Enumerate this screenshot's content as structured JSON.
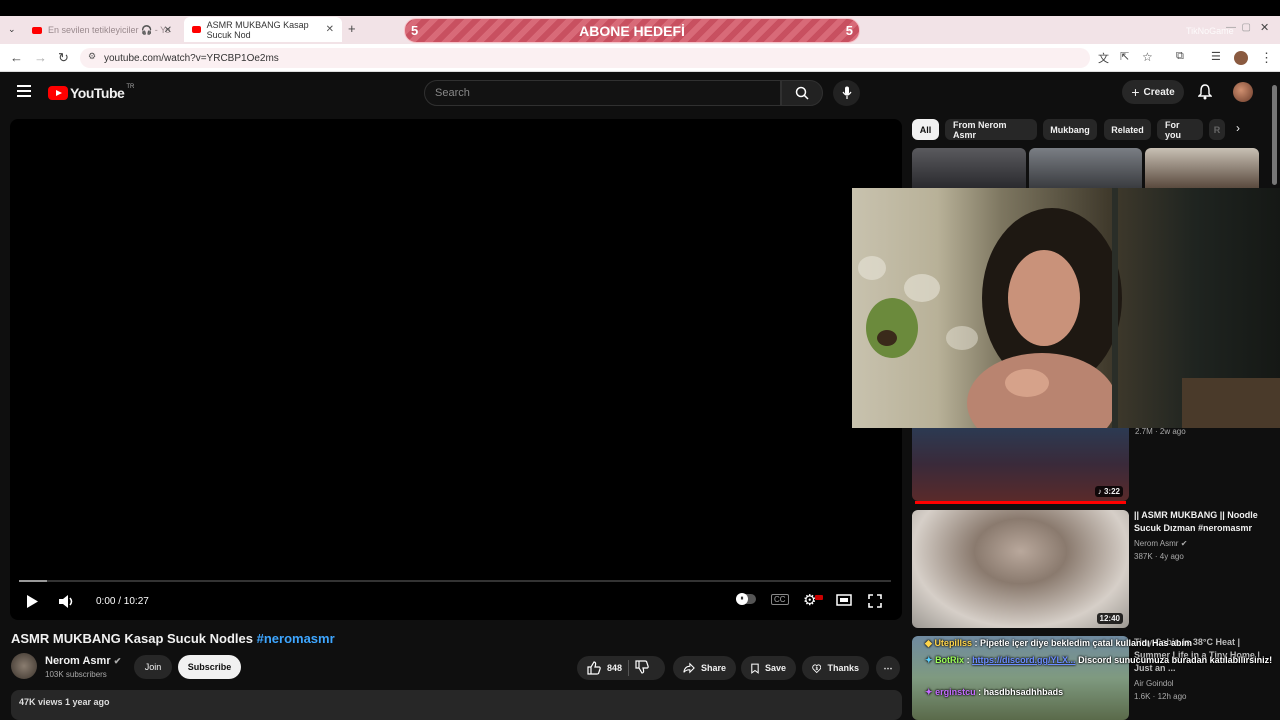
{
  "browser": {
    "tabs": [
      {
        "title": "En sevilen tetikleyiciler 🎧 - Yo",
        "active": false
      },
      {
        "title": "ASMR MUKBANG Kasap Sucuk Nod",
        "active": true
      }
    ],
    "new_tab": "+",
    "url": "youtube.com/watch?v=YRCBP1Oe2ms"
  },
  "overlay": {
    "goal_left": "5",
    "goal_label": "ABONE HEDEFİ",
    "goal_right": "5",
    "watermark": "TikNoGame"
  },
  "youtube": {
    "logo": "YouTube",
    "region": "TR",
    "search_placeholder": "Search",
    "create_label": "Create"
  },
  "player": {
    "time": "0:00 / 10:27",
    "progress": 0.0
  },
  "video": {
    "title": "ASMR MUKBANG Kasap Sucuk Nodles",
    "hashtag": "#neromasmr",
    "channel": "Nerom Asmr",
    "subscribers": "103K subscribers",
    "join_label": "Join",
    "subscribe_label": "Subscribe",
    "likes": "848",
    "share_label": "Share",
    "save_label": "Save",
    "thanks_label": "Thanks",
    "views_line": "47K views  1 year ago"
  },
  "chips": [
    "All",
    "From Nerom Asmr",
    "Mukbang",
    "Related",
    "For you",
    "R"
  ],
  "recommendations": [
    {
      "duration": "3:22",
      "meta": "2.7M · 2w ago"
    },
    {
      "title": "|| ASMR MUKBANG || Noodle Sucuk Dızman #neromasmr",
      "channel": "Nerom Asmr",
      "meta": "387K · 4y ago",
      "duration": "12:40"
    },
    {
      "title": "Tiny Cabin in 38°C Heat | Summer Life in a Tiny Home | Just an ...",
      "channel": "Air Goindol",
      "meta": "1.6K · 12h ago"
    }
  ],
  "chat": [
    {
      "user": "Utepillss",
      "message": "Pipetle içer diye bekledim çatal kullandı Has abim"
    },
    {
      "user": "BotRix",
      "message": "Discord sunucumuza buradan katılabilirsiniz!",
      "link": "https://discord.gg/YLX..."
    },
    {
      "user": "erginstcu",
      "message": "hasdbhsadhhbads"
    }
  ],
  "colors": {
    "yt_red": "#ff0000",
    "link_blue": "#3ea6ff",
    "chat_green": "#9cff57",
    "chat_purple": "#c46bff",
    "chat_yellow": "#ffd54a"
  }
}
